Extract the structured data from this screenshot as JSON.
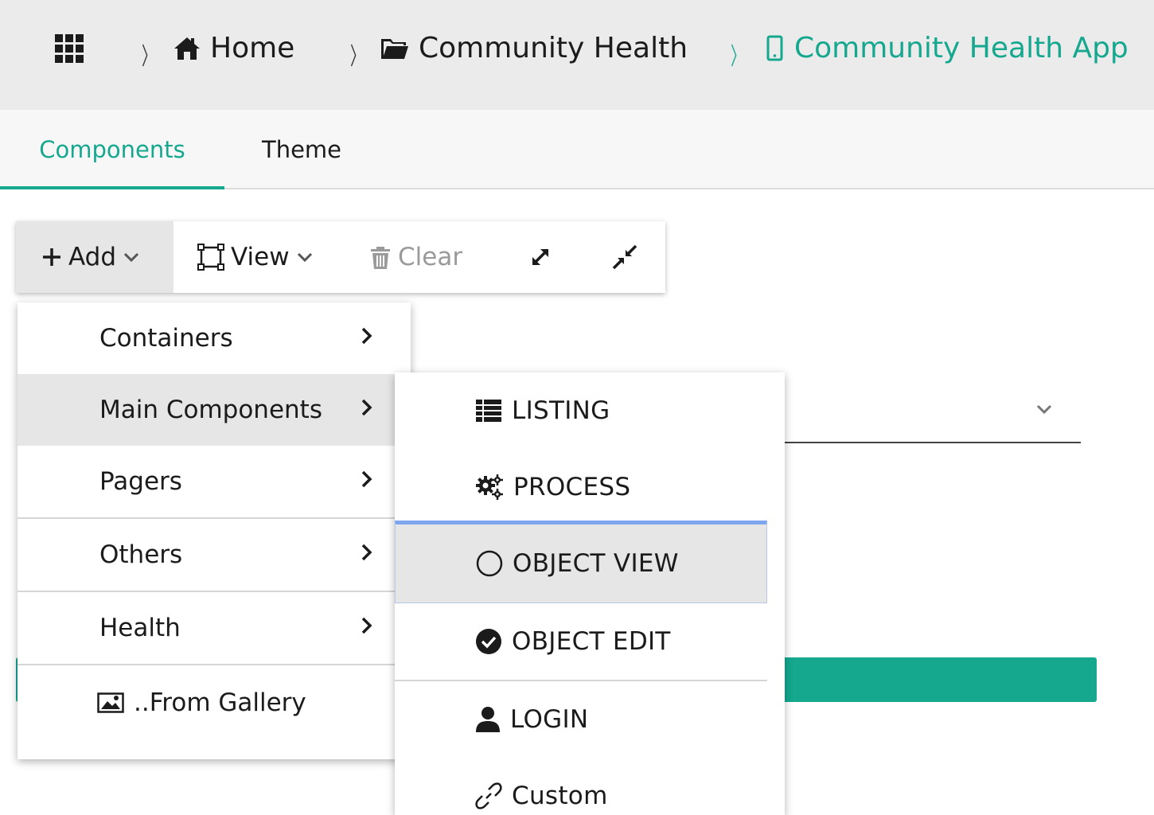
{
  "breadcrumb": {
    "apps_icon": "apps-grid-icon",
    "items": [
      {
        "label": "Home",
        "icon": "home-icon"
      },
      {
        "label": "Community Health",
        "icon": "folder-icon"
      },
      {
        "label": "Community Health App",
        "icon": "mobile-icon",
        "active": true
      }
    ]
  },
  "tabs": [
    {
      "label": "Components",
      "active": true
    },
    {
      "label": "Theme",
      "active": false
    }
  ],
  "toolbar": {
    "add_label": "Add",
    "view_label": "View",
    "clear_label": "Clear",
    "expand_icon": "expand-icon",
    "collapse_icon": "collapse-icon"
  },
  "add_menu": {
    "items": [
      {
        "label": "Containers",
        "has_submenu": true
      },
      {
        "label": "Main Components",
        "has_submenu": true,
        "hovered": true
      },
      {
        "label": "Pagers",
        "has_submenu": true
      },
      {
        "label": "Others",
        "has_submenu": true
      },
      {
        "label": "Health",
        "has_submenu": true
      },
      {
        "label": "..From Gallery",
        "icon": "image-icon"
      }
    ]
  },
  "main_components_submenu": {
    "items": [
      {
        "label": "LISTING",
        "icon": "table-icon"
      },
      {
        "label": "PROCESS",
        "icon": "gears-icon"
      },
      {
        "label": "OBJECT VIEW",
        "icon": "circle-icon",
        "highlighted": true
      },
      {
        "label": "OBJECT EDIT",
        "icon": "check-circle-icon"
      },
      {
        "label": "LOGIN",
        "icon": "user-icon"
      },
      {
        "label": "Custom",
        "icon": "link-icon"
      }
    ]
  },
  "colors": {
    "accent": "#15a88f",
    "topbar_bg": "#ebebeb",
    "hover_bg": "#e6e6e6",
    "focus_border": "#7ea6ee"
  }
}
